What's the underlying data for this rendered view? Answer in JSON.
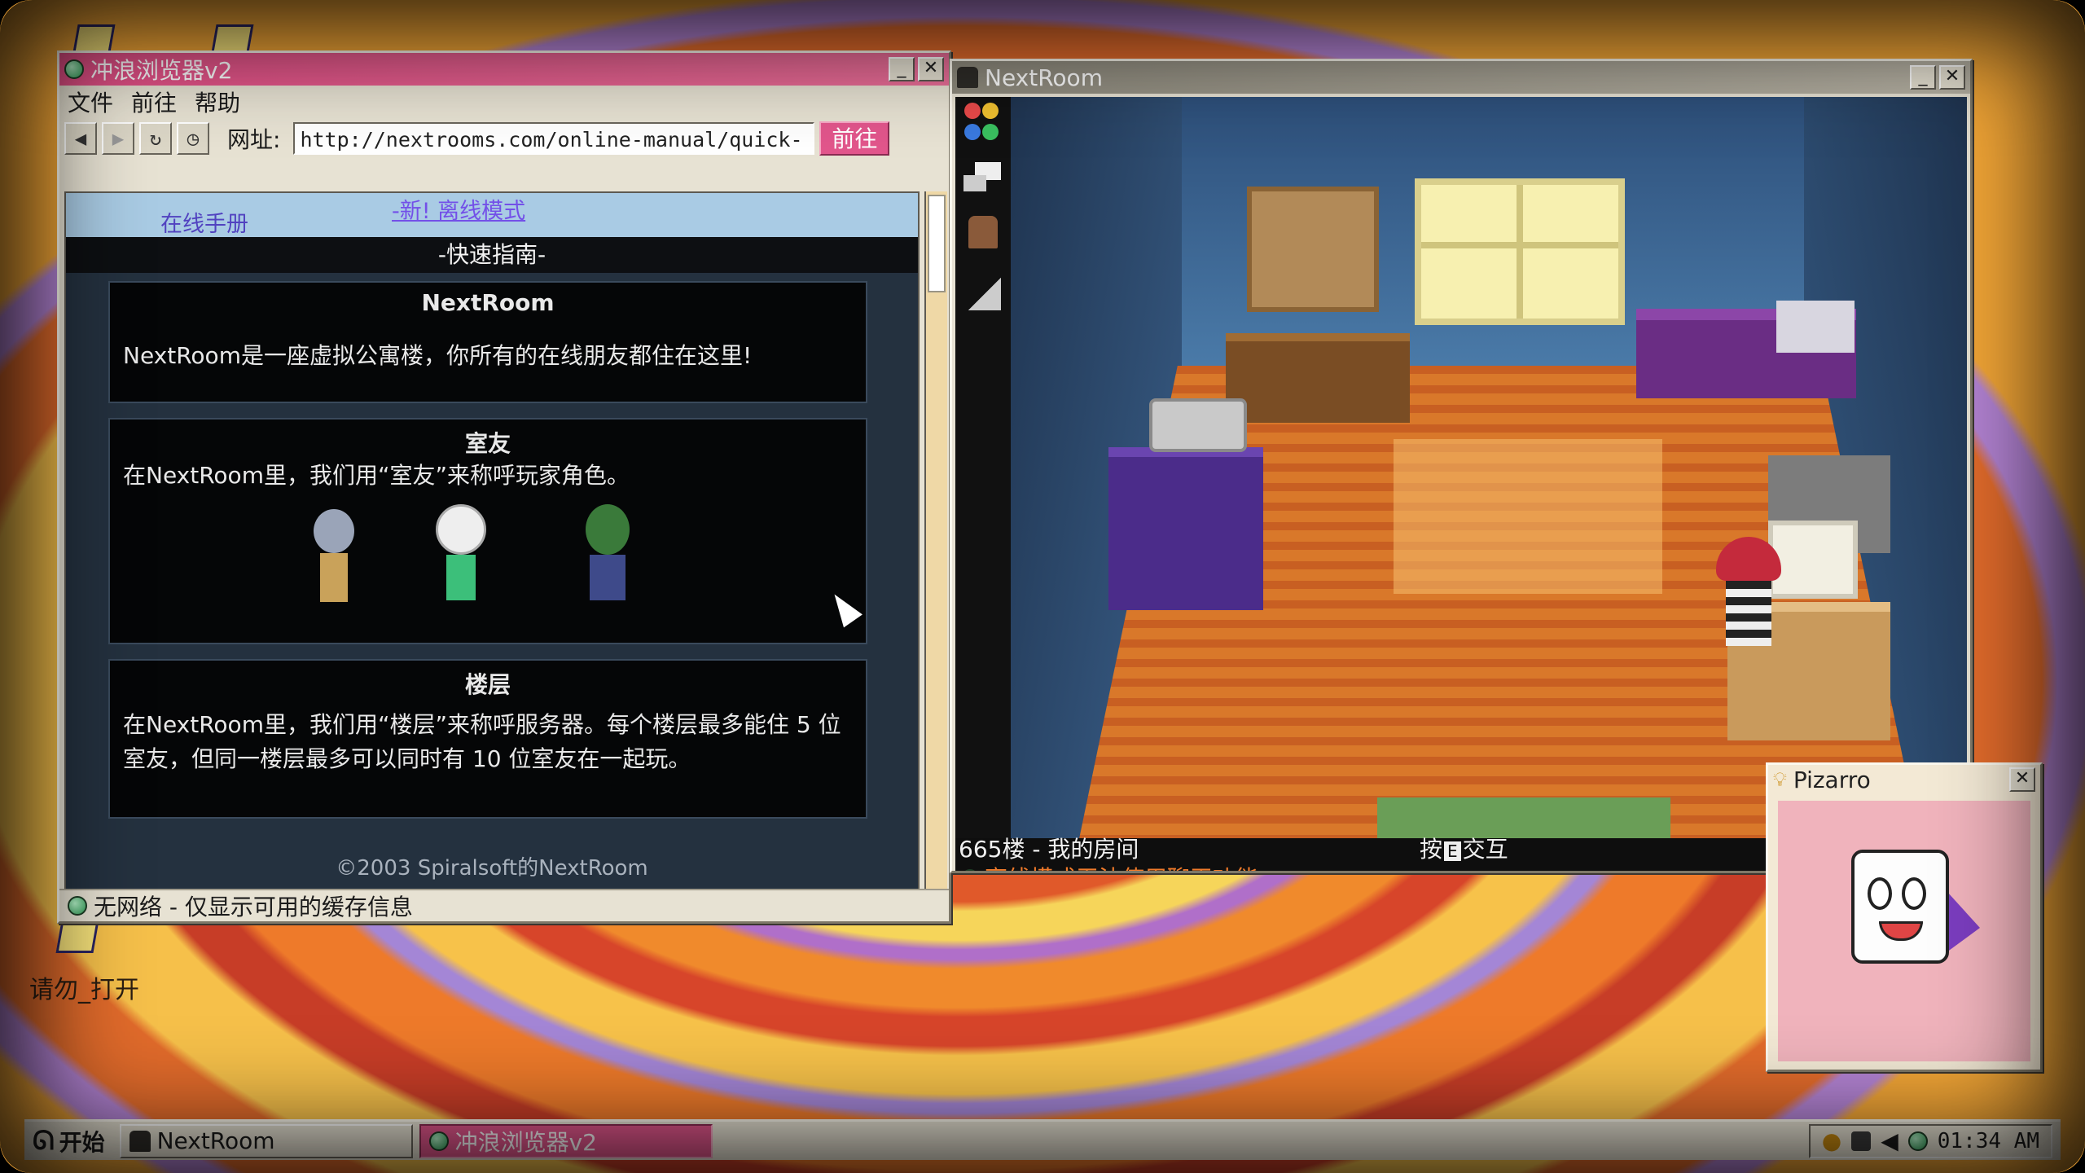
{
  "desktop": {
    "icon_bottom_label": "请勿_打开",
    "accent_colors": {
      "titlebar_pink": "#e34f86",
      "go_button": "#e2568c",
      "wallpaper_orange": "#f3a636",
      "wallpaper_purple": "#b383d3"
    }
  },
  "browser": {
    "title": "冲浪浏览器v2",
    "menu": [
      "文件",
      "前往",
      "帮助"
    ],
    "toolbar": {
      "back_icon": "back-arrow-icon",
      "forward_icon": "forward-arrow-icon",
      "refresh_icon": "refresh-icon",
      "history_icon": "clock-icon",
      "url_label": "网址:",
      "url_value": "http://nextrooms.com/online-manual/quick-",
      "go_label": "前往"
    },
    "page": {
      "manual_link": "在线手册",
      "offline_link": "-新! 离线模式",
      "guide_heading": "-快速指南-",
      "sections": [
        {
          "heading": "NextRoom",
          "body": "NextRoom是一座虚拟公寓楼，你所有的在线朋友都住在这里!"
        },
        {
          "heading": "室友",
          "body": "在NextRoom里，我们用“室友”来称呼玩家角色。"
        },
        {
          "heading": "楼层",
          "body": "在NextRoom里，我们用“楼层”来称呼服务器。每个楼层最多能住 5 位室友，但同一楼层最多可以同时有 10 位室友在一起玩。"
        }
      ],
      "footer": "©2003 Spiralsoft的NextRoom"
    },
    "status": "无网络 - 仅显示可用的缓存信息"
  },
  "game": {
    "title": "NextRoom",
    "location": "665楼 - 我的房间",
    "prompt_prefix": "按",
    "prompt_key": "E",
    "prompt_suffix": "交互",
    "chat_notice": "离线模式无法使用聊天功能"
  },
  "pizarro": {
    "title": "Pizarro"
  },
  "taskbar": {
    "start_label": "开始",
    "tasks": [
      "NextRoom",
      "冲浪浏览器v2"
    ],
    "clock": "01:34 AM"
  }
}
